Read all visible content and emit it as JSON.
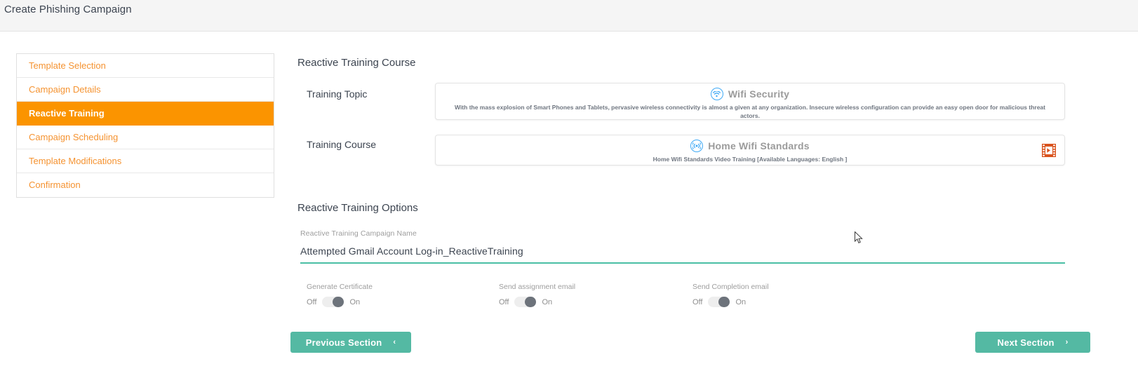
{
  "topbar": {
    "title": "Create Phishing Campaign"
  },
  "wizard": {
    "items": [
      {
        "label": "Template Selection",
        "active": false
      },
      {
        "label": "Campaign Details",
        "active": false
      },
      {
        "label": "Reactive Training",
        "active": true
      },
      {
        "label": "Campaign Scheduling",
        "active": false
      },
      {
        "label": "Template Modifications",
        "active": false
      },
      {
        "label": "Confirmation",
        "active": false
      }
    ]
  },
  "sections": {
    "course_title": "Reactive Training Course",
    "options_title": "Reactive Training Options"
  },
  "training_topic": {
    "label": "Training Topic",
    "icon": "wifi-icon",
    "name": "Wifi Security",
    "description": "With the mass explosion of Smart Phones and Tablets, pervasive wireless connectivity is almost a given at any organization. Insecure wireless configuration can provide an easy open door for malicious threat actors."
  },
  "training_course": {
    "label": "Training Course",
    "icon": "broadcast-icon",
    "name": "Home Wifi Standards",
    "description": "Home Wifi Standards Video Training [Available Languages: English ]",
    "media_icon": "video-film-icon"
  },
  "campaign_name": {
    "caption": "Reactive Training Campaign Name",
    "value": "Attempted Gmail Account Log-in_ReactiveTraining",
    "placeholder": "Reactive Training Campaign Name"
  },
  "toggles": [
    {
      "caption": "Generate Certificate",
      "off_label": "Off",
      "on_label": "On",
      "state": "off"
    },
    {
      "caption": "Send assignment email",
      "off_label": "Off",
      "on_label": "On",
      "state": "off"
    },
    {
      "caption": "Send Completion email",
      "off_label": "Off",
      "on_label": "On",
      "state": "off"
    }
  ],
  "footer": {
    "previous_label": "Previous Section",
    "previous_chevron": "‹",
    "next_label": "Next Section",
    "next_chevron": "›"
  },
  "colors": {
    "accent_orange": "#fb9400",
    "link_orange": "#f59331",
    "teal_button": "#54b9a3",
    "underline_teal": "#4abfa5",
    "icon_blue": "#3fa9f5",
    "video_icon": "#d9531e"
  }
}
